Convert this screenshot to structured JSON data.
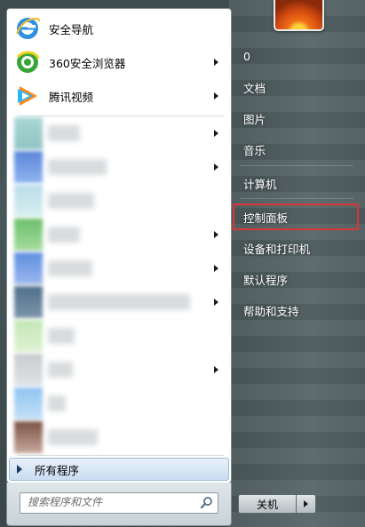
{
  "pinned": [
    {
      "label": "安全导航",
      "icon": "ie-icon",
      "has_submenu": false
    },
    {
      "label": "360安全浏览器",
      "icon": "360-browser-icon",
      "has_submenu": true
    },
    {
      "label": "腾讯视频",
      "icon": "tencent-video-icon",
      "has_submenu": true
    }
  ],
  "all_programs_label": "所有程序",
  "search": {
    "placeholder": "搜索程序和文件"
  },
  "right_pane": {
    "items": [
      {
        "label": "0"
      },
      {
        "label": "文档"
      },
      {
        "label": "图片"
      },
      {
        "label": "音乐"
      },
      {
        "label": "计算机"
      },
      {
        "label": "控制面板",
        "highlighted": true
      },
      {
        "label": "设备和打印机"
      },
      {
        "label": "默认程序"
      },
      {
        "label": "帮助和支持"
      }
    ]
  },
  "shutdown_label": "关机",
  "colors": {
    "highlight_border": "#d93636",
    "all_programs_bg": "#c9ddf1"
  }
}
